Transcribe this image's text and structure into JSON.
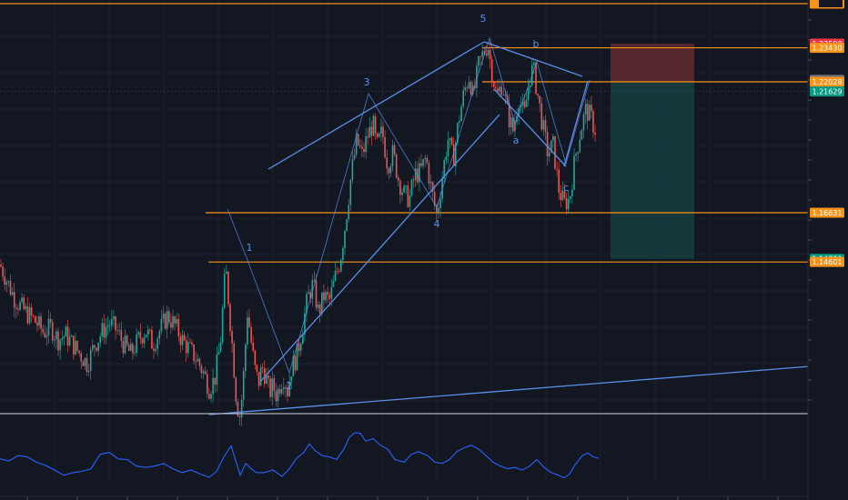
{
  "chart_data": {
    "type": "candlestick",
    "title": "",
    "xlabel": "",
    "ylabel": "",
    "price_axis": {
      "position": "right",
      "ylim": [
        1.085,
        1.2525
      ]
    },
    "colors": {
      "background": "#131722",
      "up": "#26a69a",
      "down": "#ef5350",
      "level_line": "#f7931a",
      "trend_line": "#5b8fe8",
      "oscillator": "#2962ff",
      "stop_zone": "#5c2a2e",
      "target_zone": "#163c3e"
    },
    "horizontal_levels": [
      {
        "price": 1.2525,
        "label": ""
      },
      {
        "price": 1.2343,
        "label": "1.23430"
      },
      {
        "price": 1.22028,
        "label": "1.22028"
      },
      {
        "price": 1.16631,
        "label": "1.16631"
      },
      {
        "price": 1.14601,
        "label": "1.14601"
      }
    ],
    "price_tags": [
      {
        "price": 1.23599,
        "label": "1.23599",
        "color": "#f23645"
      },
      {
        "price": 1.2343,
        "label": "1.23430",
        "color": "#f7931a"
      },
      {
        "price": 1.22112,
        "label": "1.22112",
        "color": "#6b6f78"
      },
      {
        "price": 1.22028,
        "label": "1.22028",
        "color": "#f7931a"
      },
      {
        "price": 1.21629,
        "label": "1.21629",
        "color": "#089981"
      },
      {
        "price": 1.16631,
        "label": "1.16631",
        "color": "#f7931a"
      },
      {
        "price": 1.14732,
        "label": "1.14732",
        "color": "#089981"
      },
      {
        "price": 1.14601,
        "label": "1.14601",
        "color": "#f7931a"
      }
    ],
    "position_box": {
      "entry": 1.22028,
      "stop": 1.23599,
      "target": 1.14732
    },
    "wave_labels": [
      {
        "text": "1",
        "price": 1.13
      },
      {
        "text": "2",
        "price": 1.09
      },
      {
        "text": "3",
        "price": 1.21
      },
      {
        "text": "4",
        "price": 1.14
      },
      {
        "text": "5",
        "price": 1.246
      },
      {
        "text": "a",
        "price": 1.18
      },
      {
        "text": "b",
        "price": 1.232
      },
      {
        "text": "c",
        "price": 1.158
      }
    ],
    "series": [
      {
        "points": [
          [
            0,
            1.145
          ],
          [
            8,
            1.138
          ],
          [
            16,
            1.131
          ],
          [
            24,
            1.127
          ],
          [
            32,
            1.124
          ],
          [
            40,
            1.121
          ],
          [
            48,
            1.117
          ],
          [
            56,
            1.119
          ],
          [
            64,
            1.114
          ],
          [
            72,
            1.116
          ],
          [
            80,
            1.112
          ],
          [
            88,
            1.108
          ],
          [
            96,
            1.104
          ],
          [
            104,
            1.112
          ],
          [
            112,
            1.117
          ],
          [
            120,
            1.121
          ],
          [
            128,
            1.118
          ],
          [
            136,
            1.112
          ],
          [
            144,
            1.108
          ],
          [
            152,
            1.114
          ],
          [
            160,
            1.118
          ],
          [
            168,
            1.112
          ],
          [
            176,
            1.118
          ],
          [
            184,
            1.124
          ],
          [
            192,
            1.12
          ],
          [
            200,
            1.114
          ],
          [
            208,
            1.11
          ],
          [
            216,
            1.106
          ],
          [
            224,
            1.1
          ],
          [
            230,
            1.094
          ],
          [
            236,
            1.098
          ],
          [
            242,
            1.112
          ],
          [
            248,
            1.144
          ],
          [
            252,
            1.126
          ],
          [
            256,
            1.108
          ],
          [
            260,
            1.088
          ],
          [
            264,
            1.082
          ],
          [
            268,
            1.101
          ],
          [
            272,
            1.126
          ],
          [
            276,
            1.113
          ],
          [
            280,
            1.102
          ],
          [
            284,
            1.096
          ],
          [
            288,
            1.103
          ],
          [
            292,
            1.099
          ],
          [
            296,
            1.092
          ],
          [
            300,
            1.095
          ],
          [
            304,
            1.091
          ],
          [
            308,
            1.096
          ],
          [
            312,
            1.099
          ],
          [
            316,
            1.093
          ],
          [
            320,
            1.102
          ],
          [
            326,
            1.107
          ],
          [
            332,
            1.118
          ],
          [
            338,
            1.131
          ],
          [
            344,
            1.137
          ],
          [
            350,
            1.125
          ],
          [
            356,
            1.132
          ],
          [
            362,
            1.13
          ],
          [
            368,
            1.139
          ],
          [
            374,
            1.147
          ],
          [
            380,
            1.163
          ],
          [
            386,
            1.182
          ],
          [
            392,
            1.196
          ],
          [
            398,
            1.19
          ],
          [
            404,
            1.198
          ],
          [
            410,
            1.203
          ],
          [
            414,
            1.193
          ],
          [
            420,
            1.2
          ],
          [
            426,
            1.186
          ],
          [
            432,
            1.191
          ],
          [
            438,
            1.18
          ],
          [
            444,
            1.174
          ],
          [
            450,
            1.172
          ],
          [
            456,
            1.182
          ],
          [
            462,
            1.183
          ],
          [
            468,
            1.189
          ],
          [
            474,
            1.176
          ],
          [
            480,
            1.165
          ],
          [
            486,
            1.181
          ],
          [
            492,
            1.197
          ],
          [
            498,
            1.188
          ],
          [
            504,
            1.204
          ],
          [
            510,
            1.216
          ],
          [
            516,
            1.223
          ],
          [
            520,
            1.214
          ],
          [
            526,
            1.227
          ],
          [
            532,
            1.233
          ],
          [
            536,
            1.236
          ],
          [
            540,
            1.226
          ],
          [
            546,
            1.214
          ],
          [
            552,
            1.22
          ],
          [
            558,
            1.207
          ],
          [
            564,
            1.2
          ],
          [
            570,
            1.214
          ],
          [
            576,
            1.206
          ],
          [
            582,
            1.222
          ],
          [
            586,
            1.226
          ],
          [
            590,
            1.217
          ],
          [
            596,
            1.203
          ],
          [
            602,
            1.191
          ],
          [
            608,
            1.194
          ],
          [
            614,
            1.176
          ],
          [
            620,
            1.17
          ],
          [
            626,
            1.172
          ],
          [
            632,
            1.189
          ],
          [
            638,
            1.2
          ],
          [
            644,
            1.209
          ],
          [
            650,
            1.205
          ],
          [
            654,
            1.2
          ],
          [
            656,
            1.212
          ]
        ]
      }
    ],
    "oscillator": {
      "ylim": [
        0,
        100
      ],
      "points": [
        [
          0,
          35
        ],
        [
          10,
          32
        ],
        [
          20,
          40
        ],
        [
          30,
          38
        ],
        [
          40,
          30
        ],
        [
          50,
          25
        ],
        [
          60,
          18
        ],
        [
          70,
          10
        ],
        [
          80,
          14
        ],
        [
          90,
          16
        ],
        [
          100,
          20
        ],
        [
          110,
          42
        ],
        [
          120,
          45
        ],
        [
          130,
          35
        ],
        [
          140,
          34
        ],
        [
          150,
          24
        ],
        [
          160,
          22
        ],
        [
          170,
          24
        ],
        [
          180,
          28
        ],
        [
          190,
          20
        ],
        [
          200,
          14
        ],
        [
          210,
          18
        ],
        [
          220,
          12
        ],
        [
          230,
          7
        ],
        [
          238,
          16
        ],
        [
          246,
          38
        ],
        [
          254,
          55
        ],
        [
          260,
          28
        ],
        [
          264,
          10
        ],
        [
          270,
          28
        ],
        [
          276,
          20
        ],
        [
          282,
          14
        ],
        [
          290,
          14
        ],
        [
          300,
          18
        ],
        [
          310,
          8
        ],
        [
          318,
          20
        ],
        [
          326,
          36
        ],
        [
          334,
          45
        ],
        [
          340,
          58
        ],
        [
          346,
          48
        ],
        [
          354,
          40
        ],
        [
          362,
          38
        ],
        [
          370,
          34
        ],
        [
          378,
          50
        ],
        [
          384,
          68
        ],
        [
          390,
          75
        ],
        [
          396,
          74
        ],
        [
          402,
          62
        ],
        [
          410,
          66
        ],
        [
          418,
          56
        ],
        [
          426,
          50
        ],
        [
          434,
          34
        ],
        [
          444,
          30
        ],
        [
          452,
          42
        ],
        [
          460,
          46
        ],
        [
          470,
          40
        ],
        [
          478,
          30
        ],
        [
          486,
          28
        ],
        [
          494,
          34
        ],
        [
          502,
          46
        ],
        [
          510,
          52
        ],
        [
          518,
          56
        ],
        [
          526,
          50
        ],
        [
          534,
          40
        ],
        [
          542,
          30
        ],
        [
          550,
          24
        ],
        [
          558,
          20
        ],
        [
          566,
          22
        ],
        [
          574,
          18
        ],
        [
          582,
          24
        ],
        [
          590,
          34
        ],
        [
          598,
          22
        ],
        [
          606,
          14
        ],
        [
          614,
          10
        ],
        [
          620,
          6
        ],
        [
          626,
          12
        ],
        [
          632,
          26
        ],
        [
          640,
          40
        ],
        [
          646,
          44
        ],
        [
          652,
          38
        ],
        [
          658,
          36
        ]
      ]
    }
  },
  "frame": {
    "axis_labels": []
  }
}
